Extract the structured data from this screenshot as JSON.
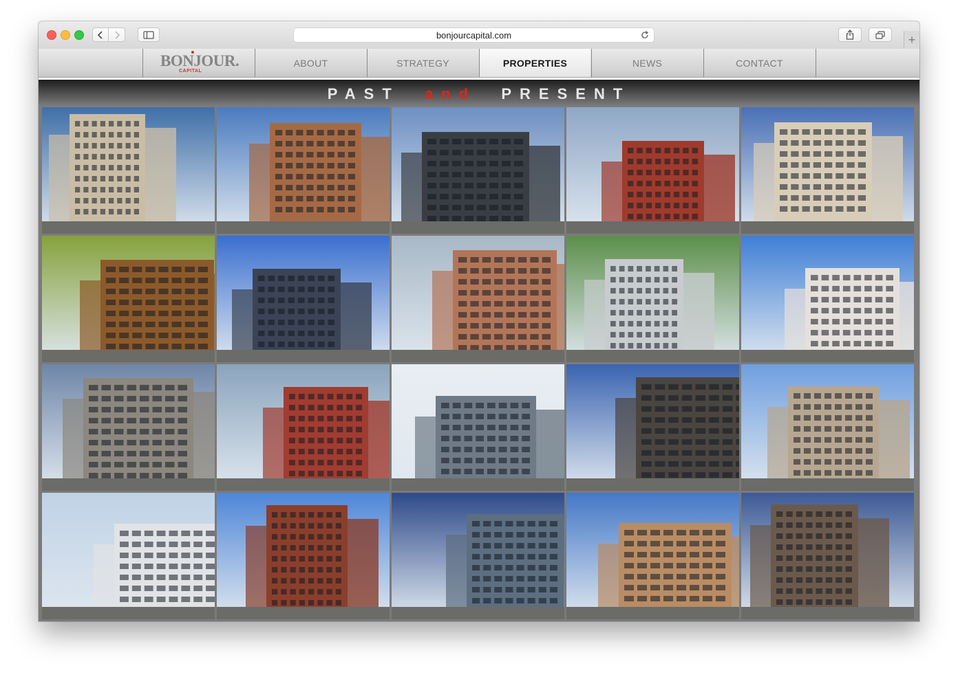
{
  "browser": {
    "url": "bonjourcapital.com",
    "icons": [
      "chevron-left-icon",
      "chevron-right-icon",
      "sidebar-icon",
      "reload-icon",
      "share-icon",
      "tabs-icon",
      "plus-icon"
    ],
    "new_tab_label": "+"
  },
  "site": {
    "logo": {
      "name": "BONJOUR.",
      "sub": "CAPITAL"
    },
    "nav": [
      {
        "label": "ABOUT",
        "active": false
      },
      {
        "label": "STRATEGY",
        "active": false
      },
      {
        "label": "PROPERTIES",
        "active": true
      },
      {
        "label": "NEWS",
        "active": false
      },
      {
        "label": "CONTACT",
        "active": false
      }
    ],
    "heading": {
      "word1": "PAST",
      "word2": "and",
      "word3": "PRESENT"
    },
    "colors": {
      "accent_red": "#e0231f",
      "logo_gray": "#858585"
    }
  },
  "properties": [
    {
      "sky": "#3f6fa8",
      "building": "#c9bda6"
    },
    {
      "sky": "#4a7bc0",
      "building": "#a56a45"
    },
    {
      "sky": "#6d8fc2",
      "building": "#3a3e44"
    },
    {
      "sky": "#8fa7c6",
      "building": "#9e3b2d"
    },
    {
      "sky": "#4a70b5",
      "building": "#d8cdb8"
    },
    {
      "sky": "#86a23c",
      "building": "#8c5a2a"
    },
    {
      "sky": "#3a6fd0",
      "building": "#3b4456"
    },
    {
      "sky": "#a8b8c6",
      "building": "#b37558"
    },
    {
      "sky": "#5c8f4a",
      "building": "#c8ccce"
    },
    {
      "sky": "#3f7fd6",
      "building": "#e6e0dc"
    },
    {
      "sky": "#6f86a8",
      "building": "#8c877f"
    },
    {
      "sky": "#8aa4bd",
      "building": "#a13c30"
    },
    {
      "sky": "#e8eef2",
      "building": "#6e7a86"
    },
    {
      "sky": "#3a64b0",
      "building": "#4a4540"
    },
    {
      "sky": "#6f9fe0",
      "building": "#b7a690"
    },
    {
      "sky": "#c0d2e6",
      "building": "#e1e3e6"
    },
    {
      "sky": "#4e86d8",
      "building": "#8a3f2c"
    },
    {
      "sky": "#2d4a8a",
      "building": "#5c6e80"
    },
    {
      "sky": "#4478c8",
      "building": "#b98c64"
    },
    {
      "sky": "#3d5a96",
      "building": "#6b5a4c"
    }
  ]
}
